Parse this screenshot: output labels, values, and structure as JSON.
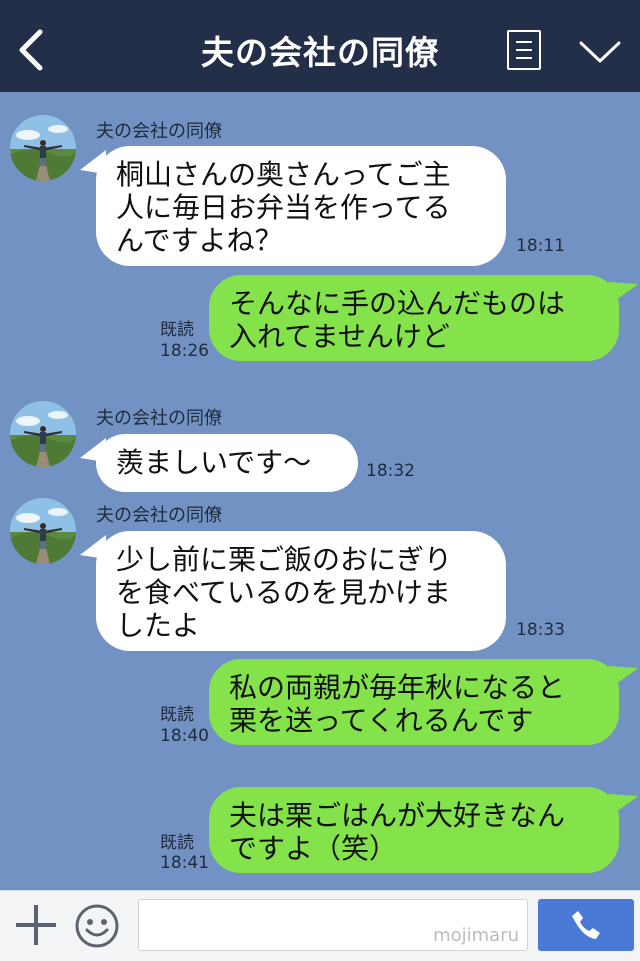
{
  "header": {
    "title": "夫の会社の同僚",
    "back_icon": "chevron-left-icon",
    "menu_icon": "menu-icon",
    "collapse_icon": "chevron-down-icon"
  },
  "messages": [
    {
      "from": "in",
      "sender": "夫の会社の同僚",
      "lines": [
        "桐山さんの奥さんってご主",
        "人に毎日お弁当を作ってる",
        "んですよね？"
      ],
      "time": "18:11"
    },
    {
      "from": "out",
      "lines": [
        "そんなに手の込んだものは",
        "入れてませんけど"
      ],
      "read": "既読",
      "time": "18:26"
    },
    {
      "from": "in",
      "sender": "夫の会社の同僚",
      "lines": [
        "羨ましいです〜"
      ],
      "time": "18:32"
    },
    {
      "from": "in",
      "sender": "夫の会社の同僚",
      "lines": [
        "少し前に栗ご飯のおにぎり",
        "を食べているのを見かけま",
        "したよ"
      ],
      "time": "18:33"
    },
    {
      "from": "out",
      "lines": [
        "私の両親が毎年秋になると",
        "栗を送ってくれるんです"
      ],
      "read": "既読",
      "time": "18:40"
    },
    {
      "from": "out",
      "lines": [
        "夫は栗ごはんが大好きなん",
        "ですよ（笑）"
      ],
      "read": "既読",
      "time": "18:41"
    }
  ],
  "footer": {
    "watermark": "mojimaru",
    "plus_icon": "plus-icon",
    "sticker_icon": "smiley-icon",
    "call_icon": "phone-icon"
  },
  "colors": {
    "header_bg": "#232f48",
    "chat_bg": "#7392c4",
    "incoming_bubble": "#ffffff",
    "outgoing_bubble": "#84e34b",
    "send_button": "#4a7ad6"
  }
}
